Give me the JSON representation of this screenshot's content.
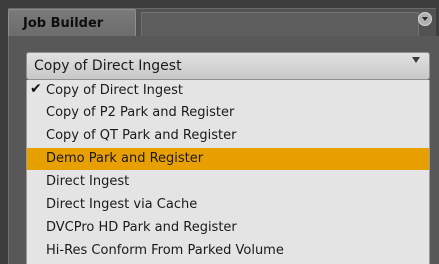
{
  "panel": {
    "tab_label": "Job Builder"
  },
  "combo": {
    "selected": "Copy of Direct Ingest"
  },
  "check_glyph": "✔",
  "dropdown": {
    "items": [
      {
        "label": "Copy of Direct Ingest",
        "checked": true,
        "highlighted": false
      },
      {
        "label": "Copy of P2 Park and Register",
        "checked": false,
        "highlighted": false
      },
      {
        "label": "Copy of QT Park and Register",
        "checked": false,
        "highlighted": false
      },
      {
        "label": "Demo Park and Register",
        "checked": false,
        "highlighted": true
      },
      {
        "label": "Direct Ingest",
        "checked": false,
        "highlighted": false
      },
      {
        "label": "Direct Ingest via Cache",
        "checked": false,
        "highlighted": false
      },
      {
        "label": "DVCPro HD Park and Register",
        "checked": false,
        "highlighted": false
      },
      {
        "label": "Hi-Res Conform From Parked Volume",
        "checked": false,
        "highlighted": false
      }
    ]
  },
  "colors": {
    "highlight": "#e8a000",
    "list_bg": "#e4e4e4",
    "panel_bg": "#585858"
  }
}
